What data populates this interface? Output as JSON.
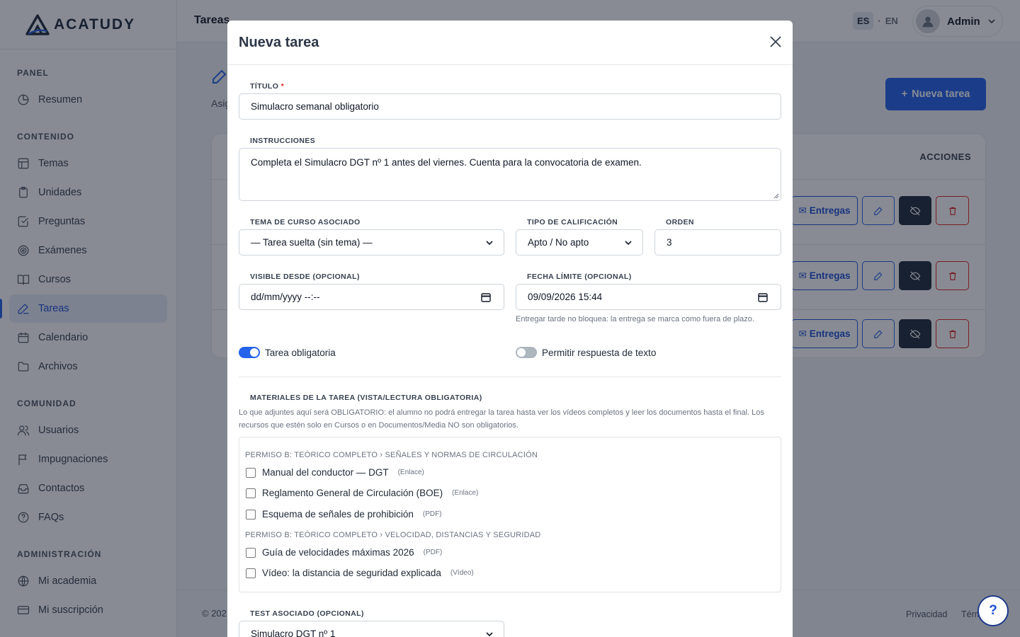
{
  "app": {
    "brand": "ACATUDY"
  },
  "sidebar": {
    "sections": [
      {
        "title": "PANEL",
        "items": [
          {
            "label": "Resumen",
            "icon": "pie-chart-icon"
          }
        ]
      },
      {
        "title": "CONTENIDO",
        "items": [
          {
            "label": "Temas",
            "icon": "layout-icon"
          },
          {
            "label": "Unidades",
            "icon": "clipboard-icon"
          },
          {
            "label": "Preguntas",
            "icon": "checkbox-icon"
          },
          {
            "label": "Exámenes",
            "icon": "target-icon"
          },
          {
            "label": "Cursos",
            "icon": "book-icon"
          },
          {
            "label": "Tareas",
            "icon": "pencil-icon",
            "active": true
          },
          {
            "label": "Calendario",
            "icon": "calendar-icon"
          },
          {
            "label": "Archivos",
            "icon": "folder-icon"
          }
        ]
      },
      {
        "title": "COMUNIDAD",
        "items": [
          {
            "label": "Usuarios",
            "icon": "users-icon"
          },
          {
            "label": "Impugnaciones",
            "icon": "flag-icon"
          },
          {
            "label": "Contactos",
            "icon": "inbox-icon"
          },
          {
            "label": "FAQs",
            "icon": "help-circle-icon"
          }
        ]
      },
      {
        "title": "ADMINISTRACIÓN",
        "items": [
          {
            "label": "Mi academia",
            "icon": "globe-icon"
          },
          {
            "label": "Mi suscripción",
            "icon": "card-icon"
          }
        ]
      }
    ]
  },
  "topbar": {
    "title": "Tareas",
    "lang_es": "ES",
    "lang_sep": "·",
    "lang_en": "EN",
    "user": "Admin"
  },
  "page": {
    "subtitle": "Asig",
    "new_button": "Nueva tarea",
    "table_actions_header": "ACCIONES",
    "row_entregas": "Entregas"
  },
  "footer": {
    "copyright": "© 202",
    "privacy": "Privacidad",
    "terms": "Térm"
  },
  "modal": {
    "title": "Nueva tarea",
    "titulo_label": "TÍTULO",
    "titulo_required": "*",
    "titulo_value": "Simulacro semanal obligatorio",
    "instrucciones_label": "INSTRUCCIONES",
    "instrucciones_value": "Completa el Simulacro DGT nº 1 antes del viernes. Cuenta para la convocatoria de examen.",
    "tema_label": "TEMA DE CURSO ASOCIADO",
    "tema_value": "— Tarea suelta (sin tema) —",
    "calif_label": "TIPO DE CALIFICACIÓN",
    "calif_value": "Apto / No apto",
    "orden_label": "ORDEN",
    "orden_value": "3",
    "visible_label": "VISIBLE DESDE (OPCIONAL)",
    "visible_value": "dd/mm/yyyy --:--",
    "fecha_label": "FECHA LÍMITE (OPCIONAL)",
    "fecha_value": "09/09/2026 15:44",
    "fecha_hint": "Entregar tarde no bloquea: la entrega se marca como fuera de plazo.",
    "obligatoria_label": "Tarea obligatoria",
    "obligatoria_on": true,
    "texto_label": "Permitir respuesta de texto",
    "texto_on": false,
    "materiales_title": "MATERIALES DE LA TAREA (VISTA/LECTURA OBLIGATORIA)",
    "materiales_desc": "Lo que adjuntes aquí será OBLIGATORIO: el alumno no podrá entregar la tarea hasta ver los vídeos completos y leer los documentos hasta el final. Los recursos que estén solo en Cursos o en Documentos/Media NO son obligatorios.",
    "groups": [
      {
        "title": "PERMISO B: TEÓRICO COMPLETO › SEÑALES Y NORMAS DE CIRCULACIÓN",
        "items": [
          {
            "label": "Manual del conductor — DGT",
            "kind": "(Enlace)"
          },
          {
            "label": "Reglamento General de Circulación (BOE)",
            "kind": "(Enlace)"
          },
          {
            "label": "Esquema de señales de prohibición",
            "kind": "(PDF)"
          }
        ]
      },
      {
        "title": "PERMISO B: TEÓRICO COMPLETO › VELOCIDAD, DISTANCIAS Y SEGURIDAD",
        "items": [
          {
            "label": "Guía de velocidades máximas 2026",
            "kind": "(PDF)"
          },
          {
            "label": "Vídeo: la distancia de seguridad explicada",
            "kind": "(Vídeo)"
          }
        ]
      }
    ],
    "test_label": "TEST ASOCIADO (OPCIONAL)",
    "test_value": "Simulacro DGT nº 1"
  },
  "help_button": "?",
  "colors": {
    "primary": "#2563eb",
    "danger": "#dc2626",
    "dark": "#1e2a3a"
  }
}
